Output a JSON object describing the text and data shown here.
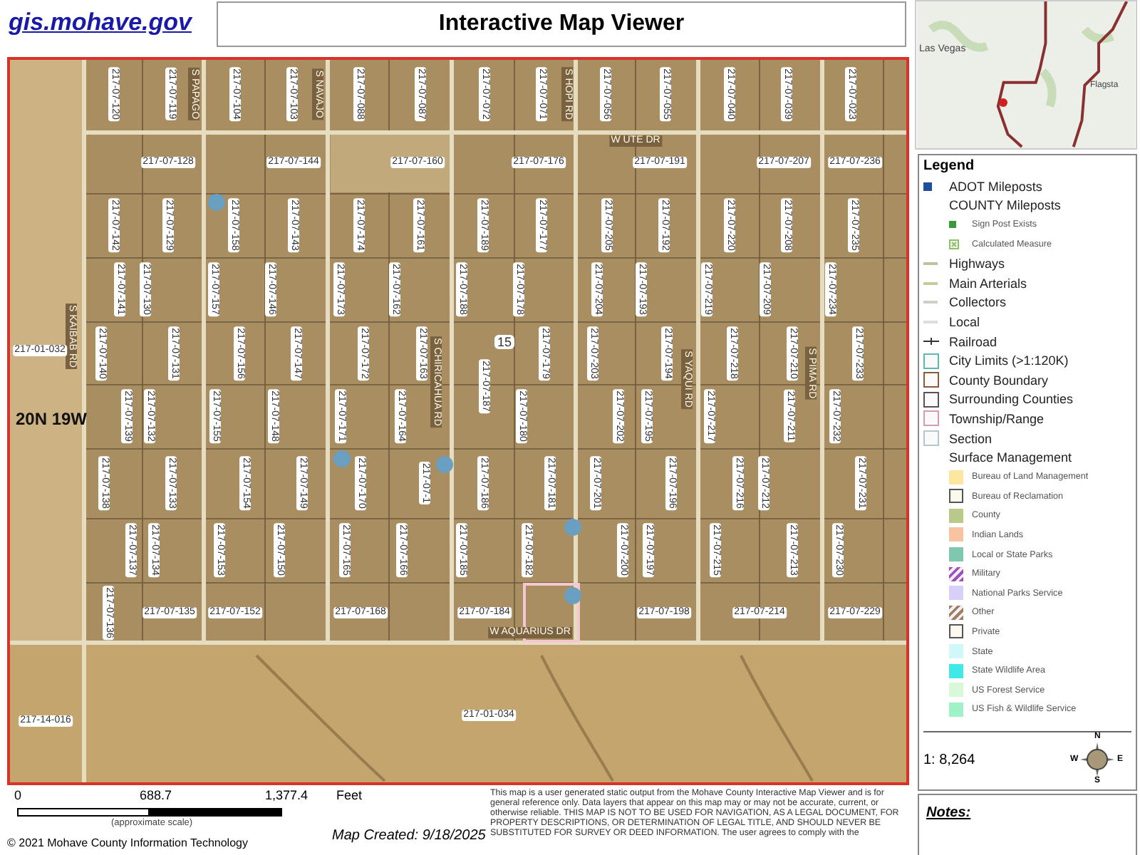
{
  "header": {
    "link": "gis.mohave.gov",
    "title": "Interactive Map Viewer"
  },
  "locator_map": {
    "labels": [
      "Las Vegas",
      "Flagsta"
    ]
  },
  "map": {
    "parcel_rows": [
      {
        "kind": "vertical",
        "parcels": [
          "217-07-120",
          "217-07-119",
          "217-07-104",
          "217-07-103",
          "217-07-088",
          "217-07-087",
          "217-07-072",
          "217-07-071",
          "217-07-056",
          "217-07-055",
          "217-07-040",
          "217-07-039",
          "217-07-023"
        ]
      },
      {
        "kind": "horizontal",
        "parcels": [
          "217-07-128",
          "217-07-144",
          "217-07-160",
          "217-07-176",
          "217-07-191",
          "217-07-207",
          "217-07-236"
        ]
      },
      {
        "kind": "vertical",
        "parcels": [
          "217-07-142",
          "217-07-129",
          "217-07-158",
          "217-07-143",
          "217-07-174",
          "217-07-161",
          "217-07-189",
          "217-07-177",
          "217-07-205",
          "217-07-192",
          "217-07-220",
          "217-07-208",
          "217-07-235"
        ]
      },
      {
        "kind": "vertical",
        "parcels": [
          "217-07-141",
          "217-07-130",
          "217-07-157",
          "217-07-146",
          "217-07-173",
          "217-07-162",
          "217-07-188",
          "217-07-178",
          "217-07-204",
          "217-07-193",
          "217-07-219",
          "217-07-209",
          "217-07-234"
        ]
      },
      {
        "kind": "vertical",
        "parcels": [
          "217-07-140",
          "217-07-131",
          "217-07-156",
          "217-07-147",
          "217-07-172",
          "217-07-163",
          "217-07-187",
          "217-07-179",
          "217-07-203",
          "217-07-194",
          "217-07-218",
          "217-07-210",
          "217-07-233"
        ]
      },
      {
        "kind": "vertical",
        "parcels": [
          "217-07-139",
          "217-07-132",
          "217-07-155",
          "217-07-148",
          "217-07-171",
          "217-07-164",
          "217-07-180",
          "217-07-202",
          "217-07-195",
          "217-07-217",
          "217-07-211",
          "217-07-232"
        ]
      },
      {
        "kind": "vertical",
        "parcels": [
          "217-07-138",
          "217-07-133",
          "217-07-154",
          "217-07-149",
          "217-07-170",
          "217-07-1",
          "217-07-186",
          "217-07-181",
          "217-07-201",
          "217-07-196",
          "217-07-216",
          "217-07-212",
          "217-07-231"
        ]
      },
      {
        "kind": "vertical",
        "parcels": [
          "217-07-137",
          "217-07-134",
          "217-07-153",
          "217-07-150",
          "217-07-165",
          "217-07-166",
          "217-07-185",
          "217-07-182",
          "217-07-200",
          "217-07-197",
          "217-07-215",
          "217-07-213",
          "217-07-230"
        ]
      },
      {
        "kind": "vertical",
        "parcels": [
          "217-07-136"
        ]
      },
      {
        "kind": "horizontal",
        "parcels": [
          "217-07-135",
          "217-07-152",
          "217-07-168",
          "217-07-184",
          "217-07-198",
          "217-07-214",
          "217-07-229"
        ]
      }
    ],
    "other_parcels": [
      "217-01-032",
      "217-01-034",
      "217-14-016"
    ],
    "section": "15",
    "township": "20N 19W",
    "roads": [
      {
        "name": "S KAIBAB RD",
        "kind": "vertical"
      },
      {
        "name": "S PAPAGO",
        "kind": "vertical"
      },
      {
        "name": "S NAVAJO",
        "kind": "vertical"
      },
      {
        "name": "S HOPI RD",
        "kind": "vertical"
      },
      {
        "name": "W UTE DR",
        "kind": "horizontal"
      },
      {
        "name": "S CHIRICAHUA RD",
        "kind": "vertical"
      },
      {
        "name": "S YAQUI RD",
        "kind": "vertical"
      },
      {
        "name": "S PIMA RD",
        "kind": "vertical"
      },
      {
        "name": "W AQUARIUS DR",
        "kind": "horizontal"
      }
    ]
  },
  "legend": {
    "title": "Legend",
    "items": [
      {
        "label": "ADOT Mileposts",
        "kind": "point",
        "color": "#1f4e9a"
      },
      {
        "label": "COUNTY Mileposts",
        "kind": "group"
      },
      {
        "label": "Sign Post Exists",
        "kind": "sub-point",
        "color": "#3a9a3a"
      },
      {
        "label": "Calculated Measure",
        "kind": "sub-cross",
        "color": "#8fbf6f"
      },
      {
        "label": "Highways",
        "kind": "line",
        "color": "#b8c49a"
      },
      {
        "label": "Main Arterials",
        "kind": "line",
        "color": "#c4cc9a"
      },
      {
        "label": "Collectors",
        "kind": "line",
        "color": "#d0d0c8"
      },
      {
        "label": "Local",
        "kind": "line",
        "color": "#dcdcd8"
      },
      {
        "label": "Railroad",
        "kind": "railroad",
        "color": "#333333"
      },
      {
        "label": "City Limits (>1:120K)",
        "kind": "outline",
        "color": "#5fb8b0"
      },
      {
        "label": "County Boundary",
        "kind": "outline",
        "color": "#8a5a3a"
      },
      {
        "label": "Surrounding Counties",
        "kind": "outline",
        "color": "#555555"
      },
      {
        "label": "Township/Range",
        "kind": "outline",
        "color": "#d89aae"
      },
      {
        "label": "Section",
        "kind": "outline",
        "color": "#b8c4d0"
      },
      {
        "label": "Surface Management",
        "kind": "heading"
      },
      {
        "label": "Bureau of Land Management",
        "kind": "fill",
        "color": "#fce6a0"
      },
      {
        "label": "Bureau of Reclamation",
        "kind": "boxed",
        "color": "#f8fbec"
      },
      {
        "label": "County",
        "kind": "fill",
        "color": "#b9c98a"
      },
      {
        "label": "Indian Lands",
        "kind": "fill",
        "color": "#f9c2a0"
      },
      {
        "label": "Local or State Parks",
        "kind": "fill",
        "color": "#7fc8b0"
      },
      {
        "label": "Military",
        "kind": "hatch",
        "color": "#a050c0"
      },
      {
        "label": "National Parks Service",
        "kind": "fill",
        "color": "#d8d0f8"
      },
      {
        "label": "Other",
        "kind": "hatch",
        "color": "#a08060"
      },
      {
        "label": "Private",
        "kind": "boxed",
        "color": "#fff8f0"
      },
      {
        "label": "State",
        "kind": "fill",
        "color": "#d0f8f8"
      },
      {
        "label": "State Wildlife Area",
        "kind": "fill",
        "color": "#40e8e8"
      },
      {
        "label": "US Forest Service",
        "kind": "fill",
        "color": "#d8f8d8"
      },
      {
        "label": "US Fish & Wildlife Service",
        "kind": "fill",
        "color": "#a0f0c8"
      }
    ],
    "scale": "1: 8,264",
    "compass": [
      "N",
      "E",
      "S",
      "W"
    ]
  },
  "scale_bar": {
    "ticks": [
      "0",
      "688.7",
      "1,377.4"
    ],
    "unit": "Feet",
    "note": "(approximate scale)"
  },
  "copyright": "© 2021 Mohave County Information Technology",
  "map_created": "Map Created: 9/18/2025",
  "disclaimer": "This map is a user generated static output from the Mohave County Interactive Map Viewer and is for general reference only. Data layers that appear on this map may or may not be accurate, current, or otherwise reliable. THIS MAP IS NOT TO BE USED FOR NAVIGATION, AS A LEGAL DOCUMENT, FOR PROPERTY DESCRIPTIONS, OR DETERMINATION OF LEGAL TITLE, AND SHOULD NEVER BE SUBSTITUTED FOR SURVEY OR DEED INFORMATION. The user agrees to comply with the",
  "notes": {
    "title": "Notes:"
  }
}
